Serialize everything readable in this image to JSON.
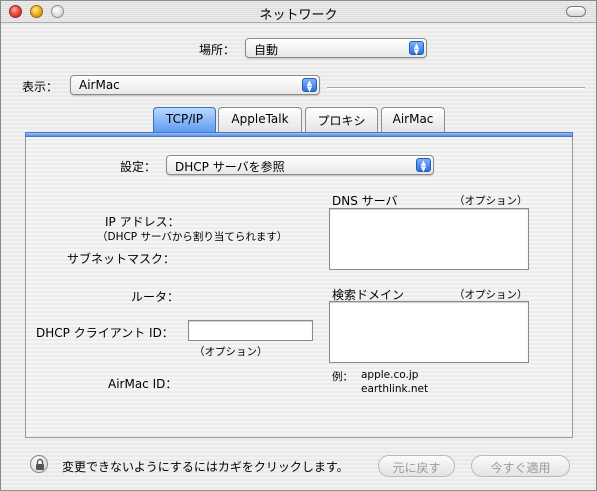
{
  "window": {
    "title": "ネットワーク"
  },
  "location": {
    "label": "場所：",
    "value": "自動"
  },
  "show": {
    "label": "表示：",
    "value": "AirMac"
  },
  "tabs": [
    {
      "label": "TCP/IP",
      "active": true
    },
    {
      "label": "AppleTalk",
      "active": false
    },
    {
      "label": "プロキシ",
      "active": false
    },
    {
      "label": "AirMac",
      "active": false
    }
  ],
  "tcpip": {
    "config_label": "設定：",
    "config_value": "DHCP サーバを参照",
    "ip_label": "IP アドレス：",
    "ip_note": "（DHCP サーバから割り当てられます）",
    "subnet_label": "サブネットマスク：",
    "router_label": "ルータ：",
    "dhcp_client_label": "DHCP クライアント ID：",
    "dhcp_client_value": "",
    "dhcp_client_note": "（オプション）",
    "airmac_id_label": "AirMac ID：",
    "dns_label": "DNS サーバ",
    "dns_optional": "（オプション）",
    "search_label": "検索ドメイン",
    "search_optional": "（オプション）",
    "example_label": "例：",
    "example_1": "apple.co.jp",
    "example_2": "earthlink.net"
  },
  "footer": {
    "lock_text": "変更できないようにするにはカギをクリックします。",
    "revert_label": "元に戻す",
    "apply_label": "今すぐ適用"
  }
}
